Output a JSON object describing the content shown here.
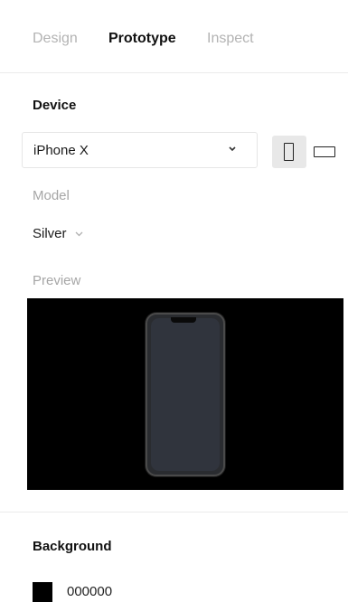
{
  "tabs": [
    {
      "label": "Design",
      "active": false
    },
    {
      "label": "Prototype",
      "active": true
    },
    {
      "label": "Inspect",
      "active": false
    }
  ],
  "device": {
    "section_title": "Device",
    "selected": "iPhone X",
    "chevron_icon": "chevron-down-icon",
    "orientation_portrait_icon": "portrait-orientation-icon",
    "orientation_landscape_icon": "landscape-orientation-icon",
    "orientation_selected": "portrait"
  },
  "model": {
    "label": "Model",
    "value": "Silver",
    "chevron_icon": "chevron-down-icon"
  },
  "preview": {
    "label": "Preview",
    "background_color": "#000000"
  },
  "background": {
    "section_title": "Background",
    "color_hex": "000000",
    "swatch_color": "#000000"
  }
}
